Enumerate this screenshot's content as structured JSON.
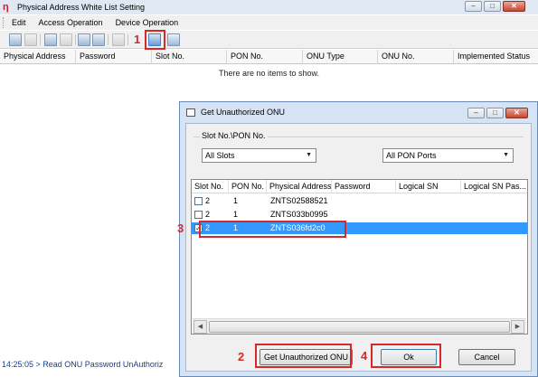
{
  "window": {
    "title": "Physical Address White List Setting",
    "logo_glyph": "ƞ",
    "controls": {
      "minimize": "–",
      "maximize": "□",
      "close": "✕"
    }
  },
  "menu": {
    "items": [
      "Edit",
      "Access Operation",
      "Device Operation"
    ]
  },
  "toolbar": {
    "icons": [
      "add-icon",
      "edit-icon",
      "import-icon",
      "export-icon",
      "copy-icon",
      "copy-all-icon",
      "delete-icon",
      "get-unauthorized-onu-icon",
      "exit-icon"
    ]
  },
  "annotations": {
    "step1": "1",
    "step2": "2",
    "step3": "3",
    "step4": "4",
    "color": "#d62a2a"
  },
  "main_table": {
    "columns": [
      "Physical Address",
      "Password",
      "Slot No.",
      "PON No.",
      "ONU Type",
      "ONU No.",
      "Implemented Status"
    ],
    "empty_message": "There are no items to show."
  },
  "status_line": "14:25:05 > Read ONU Password UnAuthoriz",
  "dialog": {
    "title": "Get Unauthorized ONU",
    "controls": {
      "minimize": "–",
      "maximize": "□",
      "close": "✕"
    },
    "group_label": "Slot No.\\PON No.",
    "slot_select": "All Slots",
    "pon_select": "All PON Ports",
    "list_columns": [
      "Slot No.",
      "PON No.",
      "Physical Address",
      "Password",
      "Logical SN",
      "Logical SN Pas..."
    ],
    "rows": [
      {
        "checked": false,
        "slot": "2",
        "pon": "1",
        "address": "ZNTS02588521",
        "selected": false
      },
      {
        "checked": false,
        "slot": "2",
        "pon": "1",
        "address": "ZNTS033b0995",
        "selected": false
      },
      {
        "checked": true,
        "slot": "2",
        "pon": "1",
        "address": "ZNTS036fd2c0",
        "selected": true
      }
    ],
    "buttons": {
      "get": "Get Unauthorized ONU",
      "ok": "Ok",
      "cancel": "Cancel"
    }
  }
}
